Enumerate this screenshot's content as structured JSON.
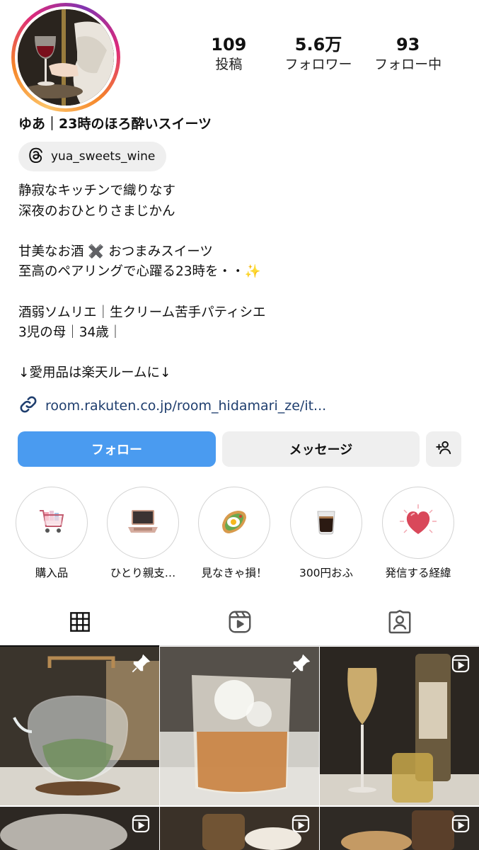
{
  "profile": {
    "display_name": "ゆあ｜23時のほろ酔いスイーツ",
    "threads_handle": "yua_sweets_wine",
    "link": "room.rakuten.co.jp/room_hidamari_ze/it..."
  },
  "stats": [
    {
      "value": "109",
      "label": "投稿"
    },
    {
      "value": "5.6万",
      "label": "フォロワー"
    },
    {
      "value": "93",
      "label": "フォロー中"
    }
  ],
  "bio_lines": [
    "静寂なキッチンで織りなす",
    "深夜のおひとりさまじかん",
    "",
    "甘美なお酒 ✖️ おつまみスイーツ",
    "至高のペアリングで心躍る23時を・・✨",
    "",
    "酒弱ソムリエ｜生クリーム苦手パティシエ",
    "3児の母｜34歳｜",
    "",
    "↓愛用品は楽天ルームに↓"
  ],
  "buttons": {
    "follow": "フォロー",
    "message": "メッセージ"
  },
  "highlights": [
    {
      "label": "購入品",
      "icon": "shopping-cart-icon"
    },
    {
      "label": "ひとり親支…",
      "icon": "laptop-icon"
    },
    {
      "label": "見なきゃ損！",
      "icon": "toast-icon"
    },
    {
      "label": "300円おふ",
      "icon": "coffee-glass-icon"
    },
    {
      "label": "発信する経緯",
      "icon": "heart-icon"
    }
  ],
  "tabs": [
    {
      "name": "posts",
      "icon": "grid-icon",
      "active": true
    },
    {
      "name": "reels",
      "icon": "reels-icon",
      "active": false
    },
    {
      "name": "tagged",
      "icon": "tagged-person-icon",
      "active": false
    }
  ],
  "colors": {
    "follow_button": "#4a9bf0",
    "link_text": "#1f3e6e",
    "secondary_button": "#efefef"
  },
  "grid_posts": [
    {
      "subject": "glass teapot",
      "badge": "pin-icon"
    },
    {
      "subject": "iced drink glass",
      "badge": "pin-icon"
    },
    {
      "subject": "wine glass and bottle",
      "badge": "reel-icon"
    },
    {
      "subject": "plate",
      "badge": "reel-icon"
    },
    {
      "subject": "bottle",
      "badge": "reel-icon"
    },
    {
      "subject": "dessert",
      "badge": "reel-icon"
    }
  ]
}
